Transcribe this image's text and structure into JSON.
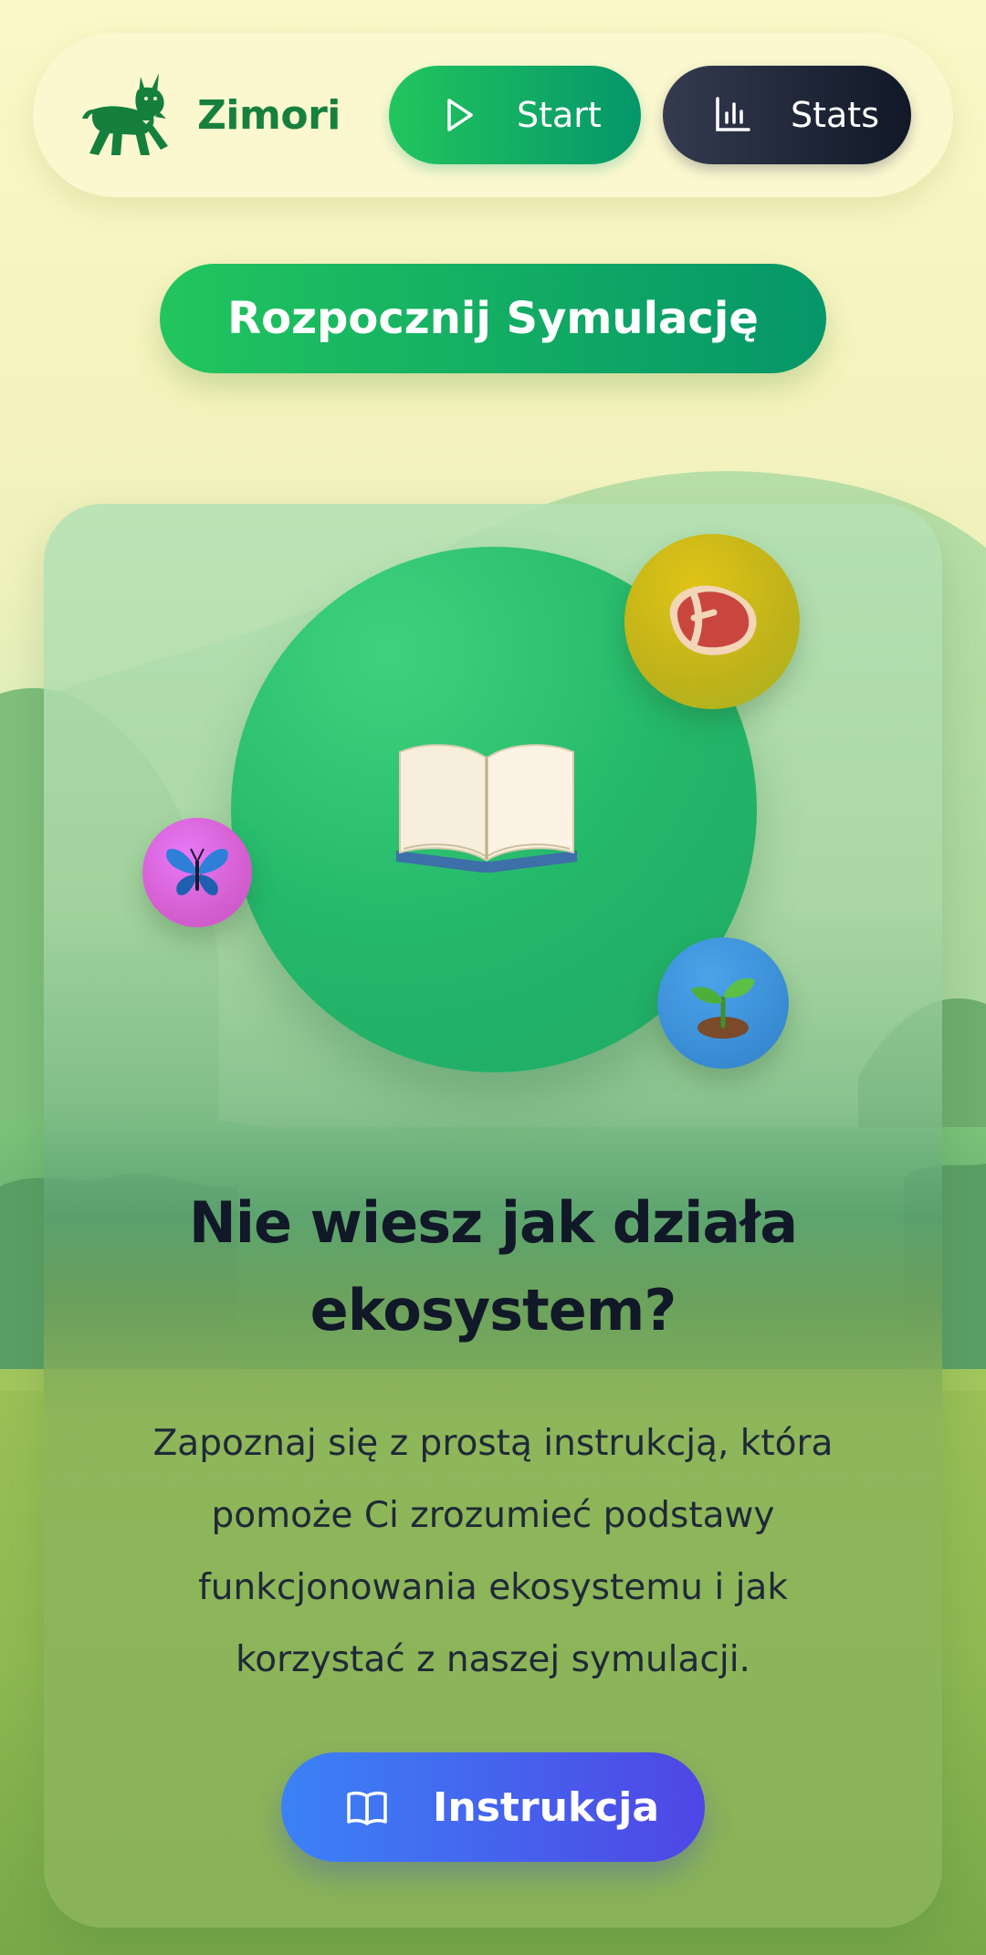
{
  "navbar": {
    "brand_name": "Zimori",
    "start_label": "Start",
    "stats_label": "Stats"
  },
  "cta": {
    "label": "Rozpocznij Symulację"
  },
  "card": {
    "title_line1": "Nie wiesz jak działa",
    "title_line2": "ekosystem?",
    "desc_line1": "Zapoznaj się z prostą instrukcją, która",
    "desc_line2": "pomoże Ci zrozumieć podstawy",
    "desc_line3": "funkcjonowania ekosystemu i jak",
    "desc_line4": "korzystać z naszej symulacji.",
    "button_label": "Instrukcja"
  },
  "icons": {
    "brand": "lynx-logo-icon",
    "start": "play-icon",
    "stats": "bar-chart-icon",
    "center": "open-book-icon",
    "food": "meat-icon",
    "insect": "butterfly-icon",
    "plant": "seedling-icon",
    "instruction": "book-outline-icon"
  },
  "colors": {
    "brand_green": "#17803d",
    "start_gradient": [
      "#22c55e",
      "#059669"
    ],
    "stats_gradient": [
      "#343b4f",
      "#111827"
    ],
    "instruction_gradient": [
      "#3b82f6",
      "#4f46e5"
    ],
    "background": "#fbf8c8"
  }
}
